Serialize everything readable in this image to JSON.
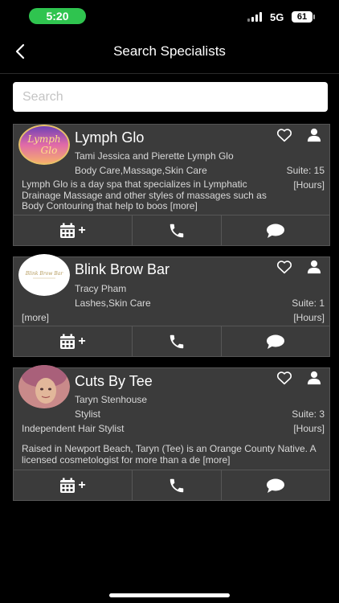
{
  "status_bar": {
    "time": "5:20",
    "network": "5G",
    "battery": "61"
  },
  "nav": {
    "title": "Search Specialists"
  },
  "search": {
    "placeholder": "Search"
  },
  "specialists": [
    {
      "name": "Lymph Glo",
      "logo_text": "Lymph Glo",
      "staff": "Tami Jessica and Pierette Lymph Glo",
      "services": "Body Care,Massage,Skin Care",
      "suite": "Suite: 15",
      "hours": "[Hours]",
      "description": "Lymph Glo is a day spa that specializes in Lymphatic Drainage Massage and other styles of massages such as Body Contouring that help to boos [more]"
    },
    {
      "name": "Blink Brow Bar",
      "logo_text": "Blink Brow Bar",
      "staff": "Tracy Pham",
      "services": "Lashes,Skin Care",
      "suite": "Suite: 1",
      "hours": "[Hours]",
      "more": "[more]"
    },
    {
      "name": "Cuts By Tee",
      "staff": "Taryn Stenhouse",
      "role": "Stylist",
      "suite": "Suite: 3",
      "services": "Independent Hair Stylist",
      "hours": "[Hours]",
      "description": "Raised in Newport Beach, Taryn (Tee) is an Orange County Native. A licensed cosmetologist for more than a de [more]"
    }
  ],
  "actions": {
    "book_plus": "+"
  },
  "icons": {
    "back": "chevron-left-icon",
    "favorite": "heart-icon",
    "profile": "person-icon",
    "book": "calendar-icon",
    "call": "phone-icon",
    "message": "chat-bubble-icon"
  }
}
